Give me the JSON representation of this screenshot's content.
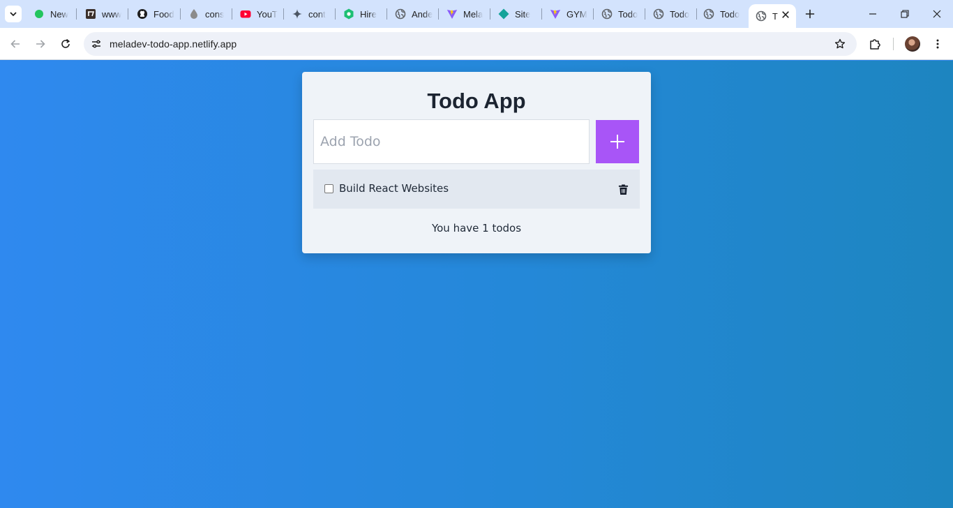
{
  "browser": {
    "tabs": [
      {
        "title": "New",
        "icon": "green-dot-icon"
      },
      {
        "title": "www",
        "icon": "tv-icon"
      },
      {
        "title": "Food",
        "icon": "github-icon"
      },
      {
        "title": "cons",
        "icon": "drop-icon"
      },
      {
        "title": "YouT",
        "icon": "youtube-icon"
      },
      {
        "title": "cont",
        "icon": "sparkle-icon"
      },
      {
        "title": "Hire",
        "icon": "hex-icon"
      },
      {
        "title": "Ande",
        "icon": "globe-icon"
      },
      {
        "title": "Mela",
        "icon": "vite-icon"
      },
      {
        "title": "Site",
        "icon": "diamond-icon"
      },
      {
        "title": "GYM",
        "icon": "vite-icon"
      },
      {
        "title": "Todo",
        "icon": "globe-icon"
      },
      {
        "title": "Todo",
        "icon": "globe-icon"
      },
      {
        "title": "Todo",
        "icon": "globe-icon"
      }
    ],
    "active_tab": {
      "title": "T",
      "icon": "globe-icon"
    },
    "url": "meladev-todo-app.netlify.app"
  },
  "app": {
    "title": "Todo App",
    "input": {
      "placeholder": "Add Todo",
      "value": ""
    },
    "todos": [
      {
        "text": "Build React Websites",
        "completed": false
      }
    ],
    "footer": "You have 1 todos"
  },
  "colors": {
    "accent": "#a855f7",
    "card": "#eff3f8",
    "todo_row": "#e2e8f0",
    "page_bg_start": "#2f89ef",
    "page_bg_end": "#1d85c0",
    "tabstrip": "#d3e3fd"
  }
}
